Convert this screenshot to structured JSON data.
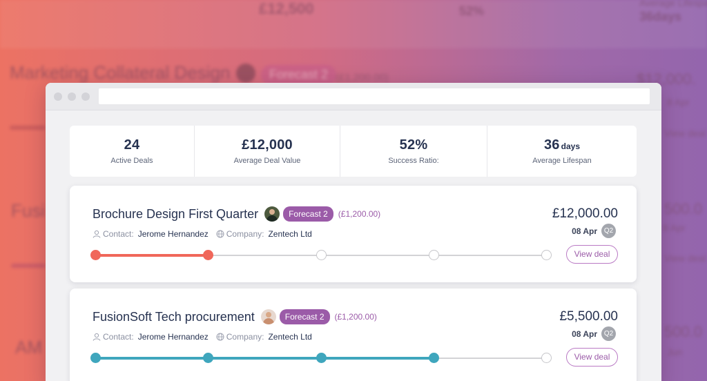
{
  "background": {
    "ghost_texts": [
      {
        "name": "ghost-deal-value",
        "text": "£12,500"
      },
      {
        "name": "ghost-success-ratio",
        "text": "52%"
      },
      {
        "name": "ghost-lifespan-label",
        "text": "Average Lifespan"
      },
      {
        "name": "ghost-lifespan-value",
        "text": "36days"
      },
      {
        "name": "ghost-deal-title",
        "text": "Marketing Collateral Design"
      },
      {
        "name": "ghost-badge",
        "text": "Forecast 2"
      },
      {
        "name": "ghost-sub-amount",
        "text": "(£1,200.00)"
      },
      {
        "name": "ghost-amount-1",
        "text": "$12,000."
      },
      {
        "name": "ghost-date-1",
        "text": "8 Apr"
      },
      {
        "name": "ghost-view-1",
        "text": "View deal"
      },
      {
        "name": "ghost-title-2",
        "text": "Fusi"
      },
      {
        "name": "ghost-amount-2",
        "text": "500.0"
      },
      {
        "name": "ghost-date-2",
        "text": "8 Apr"
      },
      {
        "name": "ghost-view-2",
        "text": "View deal"
      },
      {
        "name": "ghost-title-3",
        "text": "AM"
      },
      {
        "name": "ghost-amount-3",
        "text": "500.0"
      },
      {
        "name": "ghost-date-3",
        "text": "Jun"
      }
    ]
  },
  "stats": [
    {
      "value": "24",
      "unit": "",
      "label": "Active Deals"
    },
    {
      "value": "£12,000",
      "unit": "",
      "label": "Average Deal Value"
    },
    {
      "value": "52%",
      "unit": "",
      "label": "Success Ratio:"
    },
    {
      "value": "36",
      "unit": "days",
      "label": "Average Lifespan"
    }
  ],
  "deals": [
    {
      "title": "Brochure Design First Quarter",
      "badge": "Forecast 2",
      "sub_amount": "(£1,200.00)",
      "contact_label": "Contact:",
      "contact": "Jerome Hernandez",
      "company_label": "Company:",
      "company": "Zentech Ltd",
      "amount": "£12,000.00",
      "date": "08 Apr",
      "quarter": "Q2",
      "button": "View deal",
      "progress_color": "#f0675a",
      "stages_total": 5,
      "stages_completed": 2,
      "avatar": "dark-haired-man-avatar"
    },
    {
      "title": "FusionSoft Tech procurement",
      "badge": "Forecast 2",
      "sub_amount": "(£1,200.00)",
      "contact_label": "Contact:",
      "contact": "Jerome Hernandez",
      "company_label": "Company:",
      "company": "Zentech Ltd",
      "amount": "£5,500.00",
      "date": "08 Apr",
      "quarter": "Q2",
      "button": "View deal",
      "progress_color": "#3fa6bd",
      "stages_total": 5,
      "stages_completed": 4,
      "avatar": "blonde-woman-avatar"
    }
  ],
  "colors": {
    "accent_purple": "#9b5ba8",
    "text_dark": "#263250",
    "quarter_badge": "#a3a6ad"
  }
}
